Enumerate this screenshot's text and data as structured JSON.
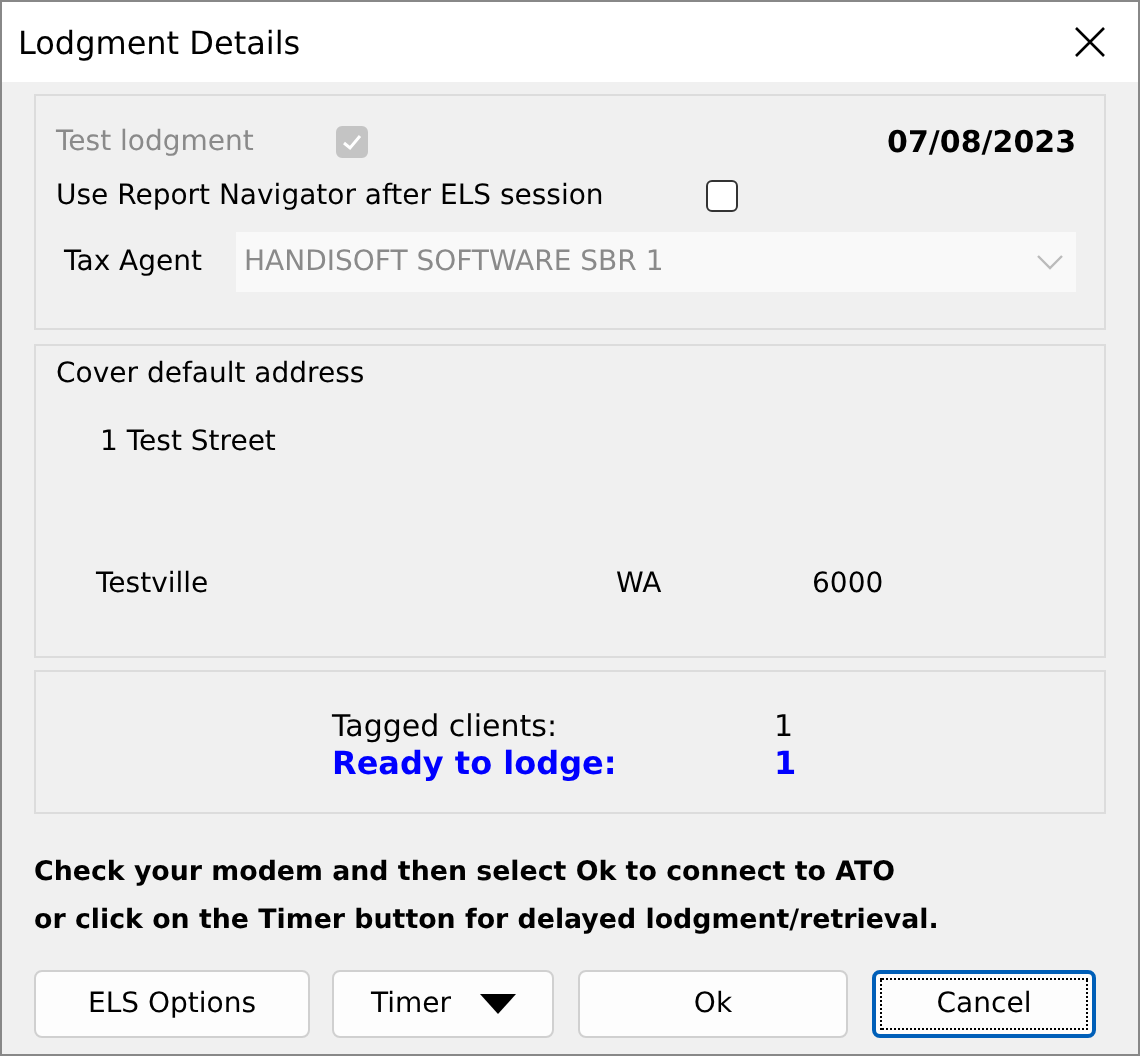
{
  "window": {
    "title": "Lodgment Details"
  },
  "options": {
    "test_lodgment": {
      "label": "Test lodgment",
      "checked": true,
      "disabled": true
    },
    "date": "07/08/2023",
    "report_navigator": {
      "label": "Use Report Navigator after ELS session",
      "checked": false,
      "disabled": false
    },
    "tax_agent": {
      "label": "Tax Agent",
      "value": "HANDISOFT SOFTWARE SBR 1",
      "disabled": true
    }
  },
  "address": {
    "title": "Cover default address",
    "street": "1 Test Street",
    "suburb": "Testville",
    "state": "WA",
    "postcode": "6000"
  },
  "summary": {
    "tagged_label": "Tagged clients:",
    "tagged_value": "1",
    "ready_label": "Ready to lodge:",
    "ready_value": "1"
  },
  "message": [
    "Check your modem and then select Ok to connect to ATO",
    "or click on the Timer button for delayed lodgment/retrieval."
  ],
  "buttons": [
    {
      "label": "ELS Options",
      "kind": "plain",
      "focused": false
    },
    {
      "label": "Timer",
      "kind": "dropdown",
      "focused": false
    },
    {
      "label": "Ok",
      "kind": "plain",
      "focused": false
    },
    {
      "label": "Cancel",
      "kind": "plain",
      "focused": true
    }
  ]
}
